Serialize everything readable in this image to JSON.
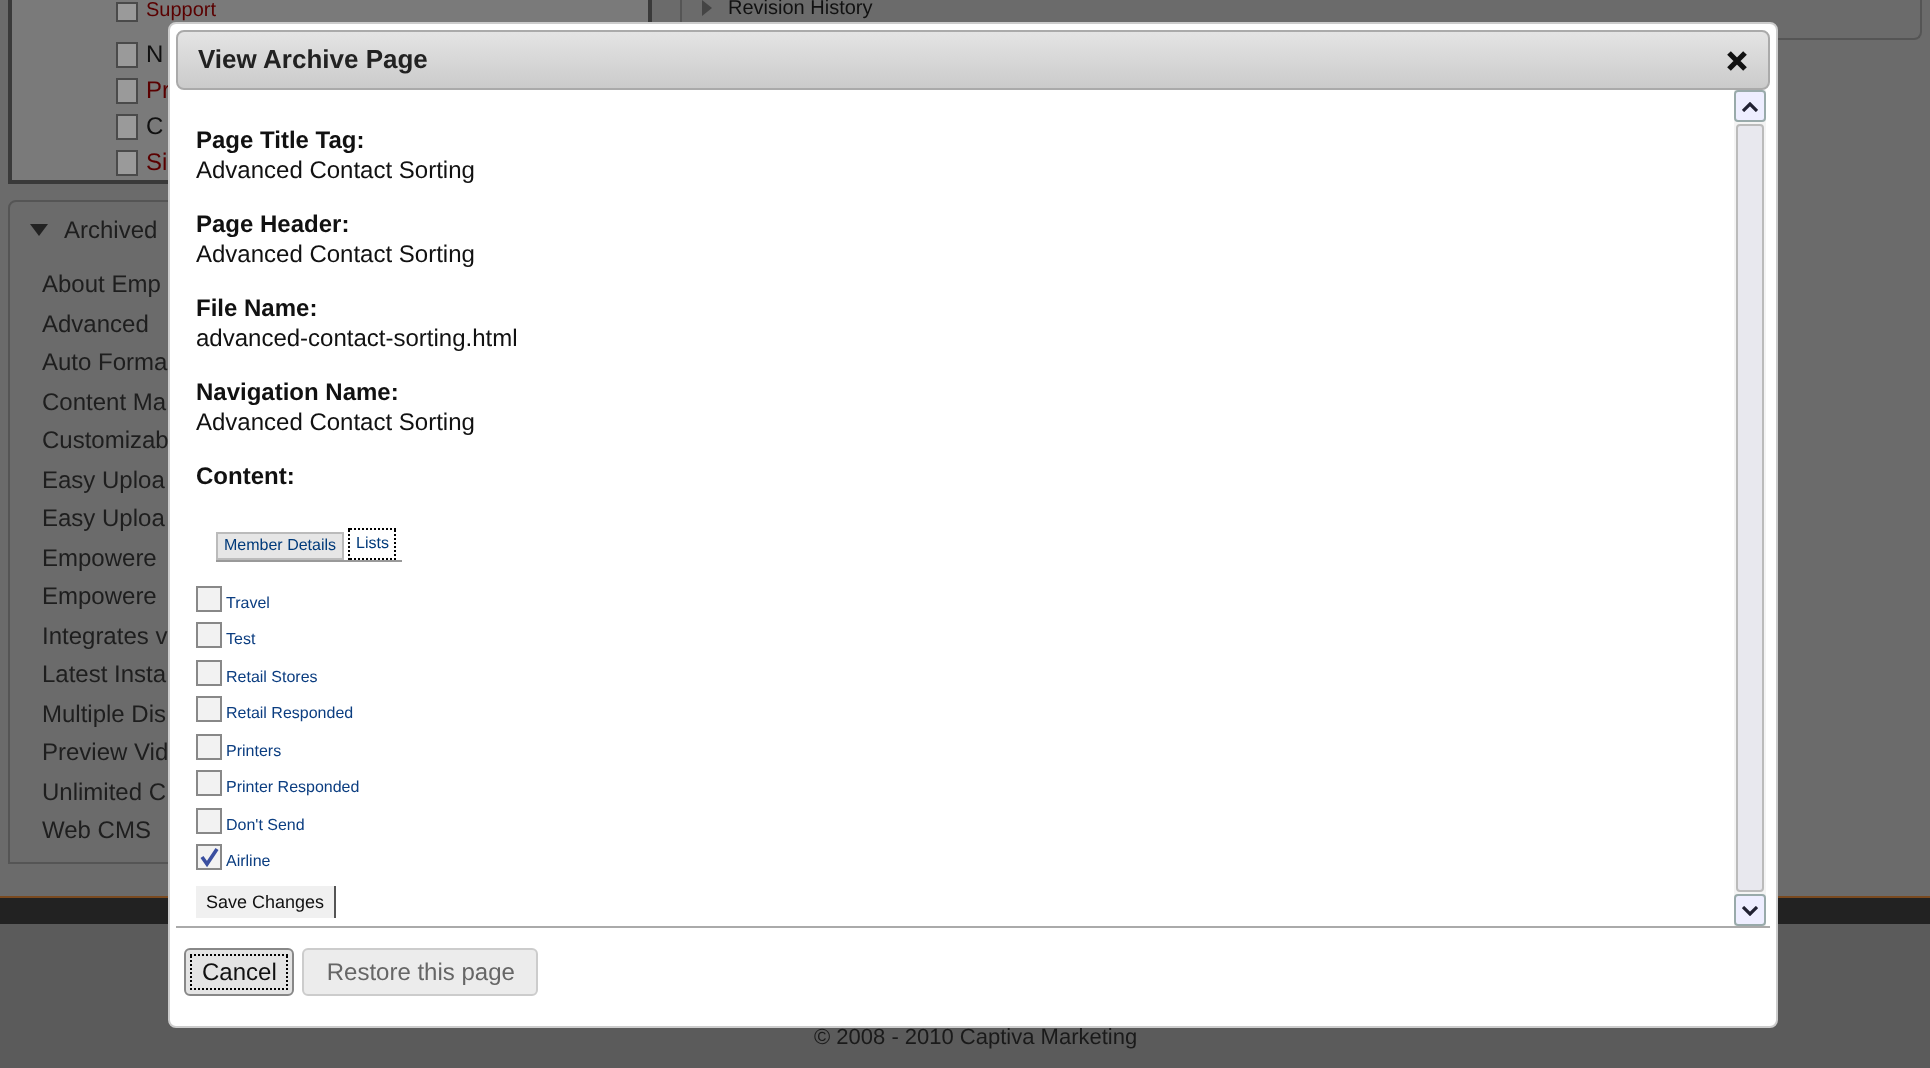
{
  "background": {
    "tree_items": [
      {
        "label": "Support",
        "color": "#5a0000"
      },
      {
        "label": "N",
        "color": "#111111"
      },
      {
        "label": "Pr",
        "color": "#5a0000"
      },
      {
        "label": "C",
        "color": "#111111"
      },
      {
        "label": "Si",
        "color": "#5a0000"
      }
    ],
    "archived_panel": {
      "title": "Archived",
      "items": [
        "About Emp",
        "Advanced",
        "Auto Forma",
        "Content Ma",
        "Customizab",
        "Easy Uploa",
        "Easy Uploa",
        "Empowere",
        "Empowere",
        "Integrates v",
        "Latest Insta",
        "Multiple Dis",
        "Preview Vid",
        "Unlimited C",
        "Web CMS"
      ]
    },
    "revision_panel": {
      "title": "Revision History"
    },
    "footer": "© 2008 - 2010 Captiva Marketing"
  },
  "dialog": {
    "title": "View Archive Page",
    "fields": [
      {
        "label": "Page Title Tag:",
        "value": "Advanced Contact Sorting"
      },
      {
        "label": "Page Header:",
        "value": "Advanced Contact Sorting"
      },
      {
        "label": "File Name:",
        "value": "advanced-contact-sorting.html"
      },
      {
        "label": "Navigation Name:",
        "value": "Advanced Contact Sorting"
      }
    ],
    "content_label": "Content:",
    "tabs": [
      {
        "label": "Member Details",
        "selected": false
      },
      {
        "label": "Lists",
        "selected": true
      }
    ],
    "lists": [
      {
        "label": "Travel",
        "checked": false
      },
      {
        "label": "Test",
        "checked": false
      },
      {
        "label": "Retail Stores",
        "checked": false
      },
      {
        "label": "Retail Responded",
        "checked": false
      },
      {
        "label": "Printers",
        "checked": false
      },
      {
        "label": "Printer Responded",
        "checked": false
      },
      {
        "label": "Don't Send",
        "checked": false
      },
      {
        "label": "Airline",
        "checked": true
      }
    ],
    "save_button": "Save Changes",
    "buttons": [
      {
        "label": "Cancel",
        "disabled": false
      },
      {
        "label": "Restore this page",
        "disabled": true
      }
    ]
  }
}
